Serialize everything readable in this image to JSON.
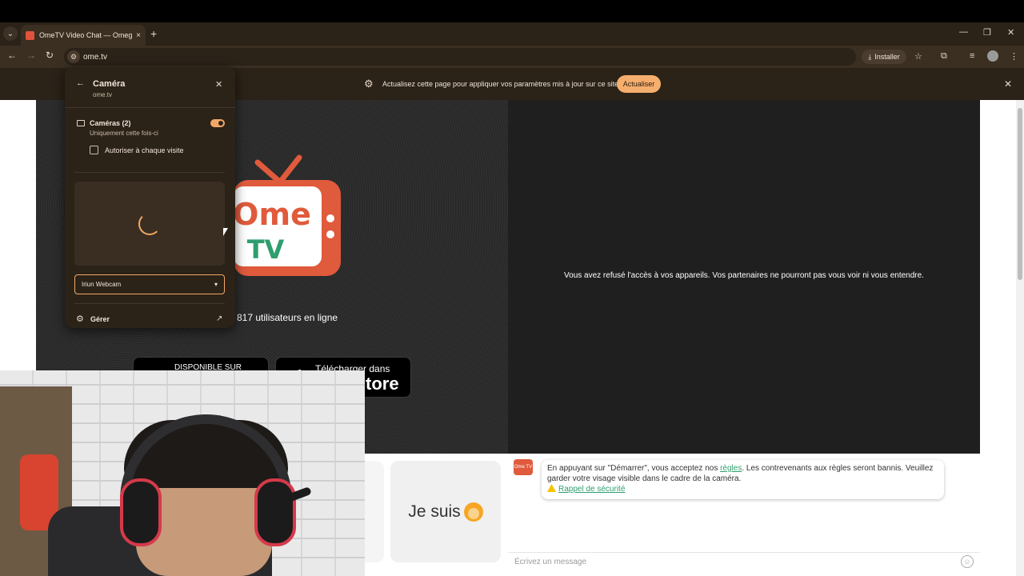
{
  "browser": {
    "tab_title": "OmeTV Video Chat — Omegle",
    "tab_close": "×",
    "new_tab": "+",
    "tab_list_icon": "⌄",
    "window_minimize": "—",
    "window_restore": "❐",
    "window_close": "✕",
    "back_icon": "←",
    "forward_icon": "→",
    "reload_icon": "↻",
    "site_info_icon": "⚙",
    "url": "ome.tv",
    "install_label": "Installer",
    "bookmark_icon": "☆",
    "extensions_icon": "⧉",
    "media_icon": "≡",
    "menu_icon": "⋮"
  },
  "infobar": {
    "gear_icon": "⚙",
    "text": "Actualisez cette page pour appliquer vos paramètres mis à jour sur ce site",
    "button": "Actualiser",
    "close": "✕"
  },
  "camera_popup": {
    "back_icon": "←",
    "title": "Caméra",
    "site": "ome.tv",
    "close": "✕",
    "cameras_label": "Caméras (2)",
    "cameras_sub": "Uniquement cette fois-ci",
    "toggle_on": true,
    "checkbox_label": "Autoriser à chaque visite",
    "selected_camera": "Iriun Webcam",
    "caret": "▾",
    "manage_label": "Gérer",
    "manage_gear": "⚙",
    "external_icon": "↗"
  },
  "page": {
    "logo_line1": "Ome",
    "logo_line2": "TV",
    "online_text": "817 utilisateurs en ligne",
    "google_play_small": "DISPONIBLE SUR",
    "app_store_small": "Télécharger dans",
    "app_store_big": "tore",
    "refused_text": "Vous avez refusé l'accès à vos appareils. Vos partenaires ne pourront pas vous voir ni vous entendre.",
    "card_text": "Je suis",
    "bot_avatar": "Ome TV",
    "bubble_text_before": "En appuyant sur \"Démarrer\", vous acceptez nos ",
    "bubble_link": "règles",
    "bubble_text_after": ". Les contrevenants aux règles seront bannis. Veuillez garder votre visage visible dans le cadre de la caméra.",
    "safety_link": "Rappel de sécurité",
    "message_placeholder": "Écrivez un message",
    "smiley": "☺"
  },
  "colors": {
    "accent": "#f3a867",
    "chrome_dark": "#2b2218",
    "logo_red": "#e05a3c",
    "logo_green": "#2f9e6f"
  }
}
